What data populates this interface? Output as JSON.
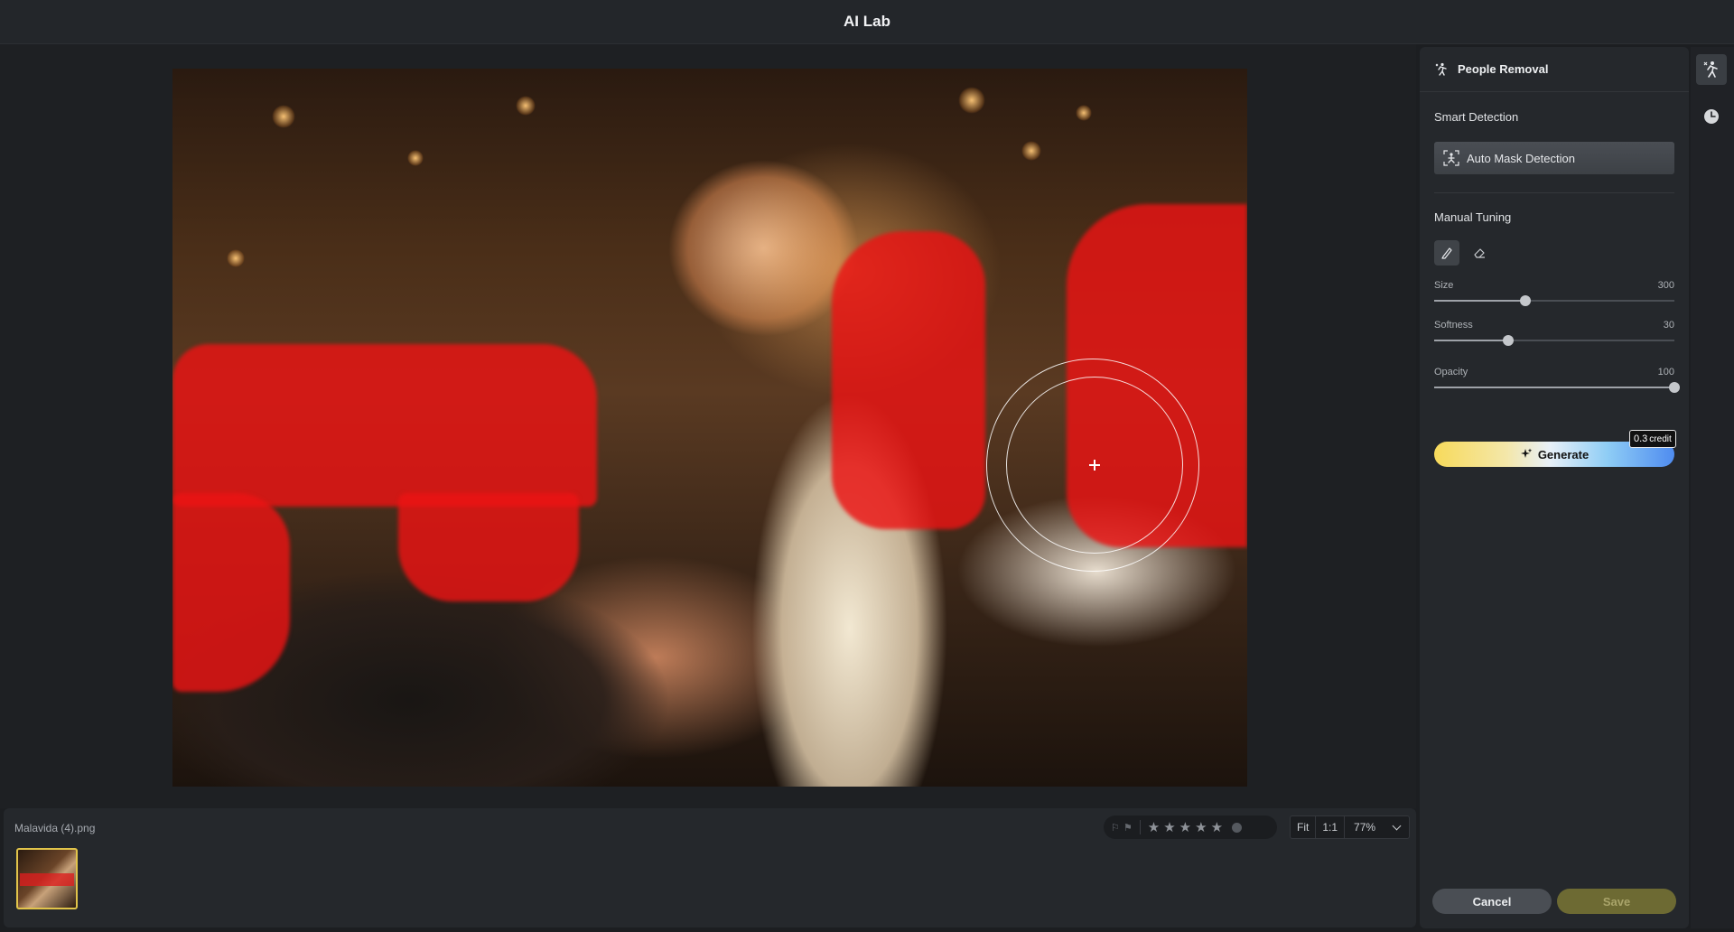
{
  "titlebar": {
    "title": "AI Lab"
  },
  "filmstrip": {
    "file_name": "Malavida (4).png",
    "rating": {
      "stars": 5,
      "filled": 0
    },
    "zoom": {
      "fit_label": "Fit",
      "one_to_one_label": "1:1",
      "value": "77%"
    }
  },
  "panel": {
    "title": "People Removal",
    "smart_detection": {
      "label": "Smart Detection",
      "auto_mask_label": "Auto Mask Detection"
    },
    "manual_tuning": {
      "label": "Manual Tuning",
      "tools": [
        "brush-icon",
        "eraser-icon"
      ],
      "sliders": [
        {
          "label": "Size",
          "value": "300",
          "fraction": 0.38
        },
        {
          "label": "Softness",
          "value": "30",
          "fraction": 0.31
        },
        {
          "label": "Opacity",
          "value": "100",
          "fraction": 1.0
        }
      ]
    },
    "generate": {
      "label": "Generate",
      "credit_value": "0.3",
      "credit_unit": "credit"
    },
    "cancel_label": "Cancel",
    "save_label": "Save"
  },
  "colors": {
    "mask": "#eb1414",
    "thumb_border": "#e1c44a",
    "save_disabled": "#6d6a33"
  }
}
